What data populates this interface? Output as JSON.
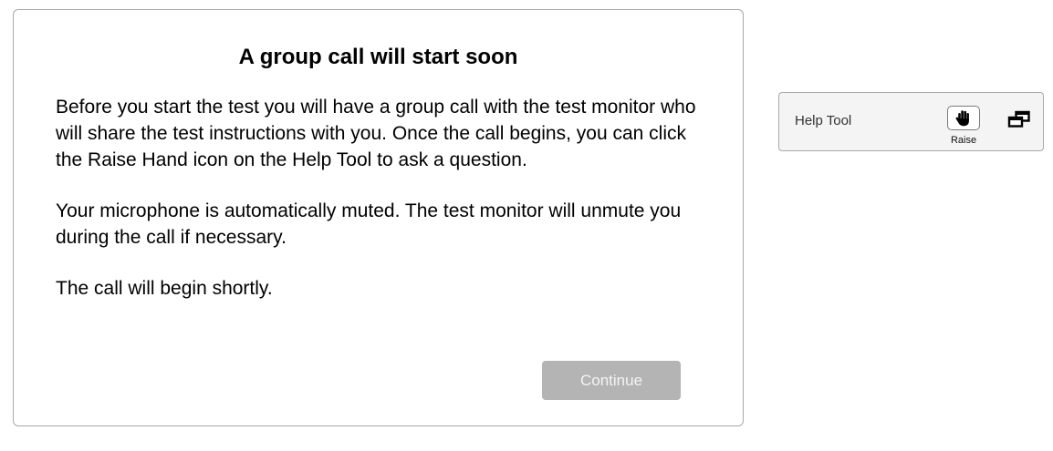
{
  "dialog": {
    "title": "A group call will start soon",
    "paragraphs": [
      "Before you start the test you will have a group call with the test monitor who will share the test instructions with you. Once the call begins, you can click the Raise Hand icon on the Help Tool to ask a question.",
      "Your microphone is automatically muted. The test monitor will unmute you during the call if necessary.",
      "The call will begin shortly."
    ],
    "continue_label": "Continue",
    "continue_state": "disabled"
  },
  "help_tool": {
    "label": "Help Tool",
    "raise_label": "Raise",
    "raise_icon": "hand-icon",
    "popout_icon": "popout-icon"
  },
  "colors": {
    "border": "#a9a9a9",
    "button_disabled_bg": "#b4b4b4",
    "button_disabled_text": "#f4f4f4",
    "help_tool_bg": "#f4f4f4"
  }
}
